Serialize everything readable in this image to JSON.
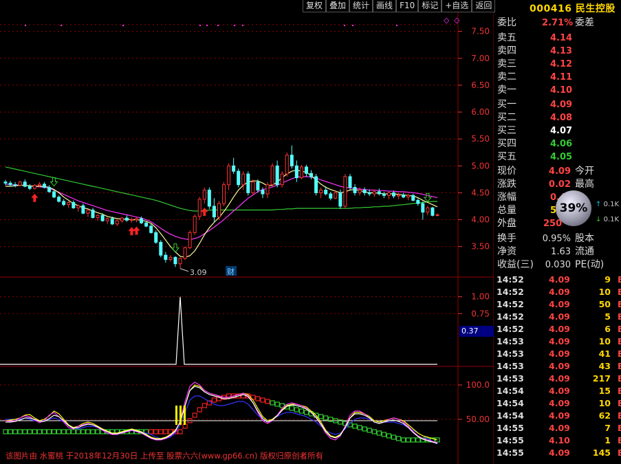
{
  "toolbar": [
    "复权",
    "叠加",
    "统计",
    "画线",
    "F10",
    "标记",
    "+自选",
    "返回"
  ],
  "stock": {
    "code": "000416",
    "name": "民生控股"
  },
  "order_book": {
    "weibi_label": "委比",
    "weibi_value": "2.71%",
    "weicha_label": "委差",
    "sells": [
      {
        "label": "卖五",
        "price": "4.14"
      },
      {
        "label": "卖四",
        "price": "4.13"
      },
      {
        "label": "卖三",
        "price": "4.12"
      },
      {
        "label": "卖二",
        "price": "4.11"
      },
      {
        "label": "卖一",
        "price": "4.10"
      }
    ],
    "buys": [
      {
        "label": "买一",
        "price": "4.09"
      },
      {
        "label": "买二",
        "price": "4.08"
      },
      {
        "label": "买三",
        "price": "4.07"
      },
      {
        "label": "买四",
        "price": "4.06"
      },
      {
        "label": "买五",
        "price": "4.05"
      }
    ]
  },
  "quote": {
    "xianjia_label": "现价",
    "xianjia": "4.09",
    "jinkai_label": "今开",
    "zhangdie_label": "涨跌",
    "zhangdie": "0.02",
    "zuigao_label": "最高",
    "zhangfu_label": "涨幅",
    "zhangfu": "0.49",
    "zongliang_label": "总量",
    "zongliang": "50",
    "waipan_label": "外盘",
    "waipan": "250",
    "huanshou_label": "换手",
    "huanshou": "0.95%",
    "guben_label": "股本",
    "jingzi_label": "净资",
    "jingzi": "1.63",
    "liutong_label": "流通",
    "shouyi_label": "收益(三)",
    "shouyi": "0.030",
    "pe_label": "PE(动)"
  },
  "badge": {
    "percent": "39%",
    "rate_up": "0.1K",
    "rate_down": "0.1K"
  },
  "ticks": [
    {
      "time": "14:52",
      "price": "4.09",
      "vol": "9"
    },
    {
      "time": "14:52",
      "price": "4.09",
      "vol": "10"
    },
    {
      "time": "14:52",
      "price": "4.09",
      "vol": "50"
    },
    {
      "time": "14:52",
      "price": "4.09",
      "vol": "5"
    },
    {
      "time": "14:52",
      "price": "4.09",
      "vol": "6"
    },
    {
      "time": "14:53",
      "price": "4.09",
      "vol": "10"
    },
    {
      "time": "14:53",
      "price": "4.09",
      "vol": "41"
    },
    {
      "time": "14:53",
      "price": "4.09",
      "vol": "43"
    },
    {
      "time": "14:53",
      "price": "4.09",
      "vol": "217"
    },
    {
      "time": "14:54",
      "price": "4.09",
      "vol": "15"
    },
    {
      "time": "14:54",
      "price": "4.09",
      "vol": "10"
    },
    {
      "time": "14:54",
      "price": "4.09",
      "vol": "62"
    },
    {
      "time": "14:55",
      "price": "4.09",
      "vol": "7"
    },
    {
      "time": "14:55",
      "price": "4.10",
      "vol": "1"
    },
    {
      "time": "14:55",
      "price": "4.09",
      "vol": "145"
    }
  ],
  "axes": {
    "main": [
      "7.50",
      "7.00",
      "6.50",
      "6.00",
      "5.50",
      "5.00",
      "4.50",
      "4.00",
      "3.50"
    ],
    "sub1": [
      "1.00",
      "0.75"
    ],
    "sub2": [
      "100.0",
      "50.00"
    ]
  },
  "sub1_value": "0.37",
  "low_label": "3.09",
  "cai_label": "财",
  "watermark": "该图片由 水蜜桃 于2018年12月30日 上传至 股票六六(www.gp66.cn) 版权归原创者所有",
  "colors": {
    "up": "#ff3333",
    "down": "#54ffff",
    "ma_white": "#ffff99",
    "ma_magenta": "#ff33ff",
    "ma_green": "#33cc33",
    "grid": "#990000"
  },
  "chart_data": {
    "type": "candlestick",
    "ylim": [
      3.1,
      7.7
    ],
    "candles": [
      [
        4.7,
        4.74,
        4.64,
        4.68
      ],
      [
        4.68,
        4.72,
        4.62,
        4.65
      ],
      [
        4.65,
        4.7,
        4.6,
        4.64
      ],
      [
        4.64,
        4.72,
        4.62,
        4.7
      ],
      [
        4.7,
        4.75,
        4.6,
        4.62
      ],
      [
        4.62,
        4.66,
        4.55,
        4.58
      ],
      [
        4.58,
        4.66,
        4.56,
        4.64
      ],
      [
        4.64,
        4.7,
        4.6,
        4.66
      ],
      [
        4.66,
        4.7,
        4.58,
        4.6
      ],
      [
        4.6,
        4.64,
        4.5,
        4.52
      ],
      [
        4.52,
        4.55,
        4.4,
        4.42
      ],
      [
        4.42,
        4.45,
        4.32,
        4.34
      ],
      [
        4.34,
        4.38,
        4.25,
        4.28
      ],
      [
        4.28,
        4.34,
        4.22,
        4.32
      ],
      [
        4.32,
        4.36,
        4.2,
        4.22
      ],
      [
        4.22,
        4.28,
        4.15,
        4.26
      ],
      [
        4.26,
        4.3,
        4.1,
        4.12
      ],
      [
        4.12,
        4.2,
        4.05,
        4.18
      ],
      [
        4.18,
        4.22,
        4.02,
        4.04
      ],
      [
        4.04,
        4.1,
        3.98,
        4.08
      ],
      [
        4.08,
        4.12,
        3.96,
        3.98
      ],
      [
        3.98,
        4.04,
        3.92,
        4.02
      ],
      [
        4.02,
        4.06,
        3.9,
        3.92
      ],
      [
        3.92,
        4.0,
        3.88,
        3.98
      ],
      [
        3.98,
        4.05,
        3.94,
        4.03
      ],
      [
        4.03,
        4.08,
        3.96,
        3.99
      ],
      [
        3.99,
        4.04,
        3.94,
        4.0
      ],
      [
        4.0,
        4.05,
        3.95,
        4.02
      ],
      [
        4.02,
        4.06,
        3.92,
        3.94
      ],
      [
        3.94,
        3.98,
        3.86,
        3.88
      ],
      [
        3.88,
        3.92,
        3.74,
        3.76
      ],
      [
        3.76,
        3.8,
        3.55,
        3.58
      ],
      [
        3.58,
        3.62,
        3.3,
        3.34
      ],
      [
        3.34,
        3.4,
        3.2,
        3.26
      ],
      [
        3.26,
        3.34,
        3.22,
        3.3
      ],
      [
        3.3,
        3.32,
        3.12,
        3.18
      ],
      [
        3.18,
        3.3,
        3.09,
        3.28
      ],
      [
        3.28,
        3.5,
        3.25,
        3.48
      ],
      [
        3.48,
        3.8,
        3.45,
        3.76
      ],
      [
        3.76,
        4.1,
        3.72,
        4.06
      ],
      [
        4.06,
        4.42,
        4.0,
        4.38
      ],
      [
        4.38,
        4.6,
        4.3,
        4.55
      ],
      [
        4.55,
        4.6,
        4.2,
        4.25
      ],
      [
        4.25,
        4.4,
        3.95,
        4.05
      ],
      [
        4.05,
        4.35,
        4.0,
        4.3
      ],
      [
        4.3,
        4.7,
        4.25,
        4.65
      ],
      [
        4.65,
        5.05,
        4.55,
        5.0
      ],
      [
        5.0,
        5.15,
        4.85,
        4.9
      ],
      [
        4.9,
        4.95,
        4.6,
        4.65
      ],
      [
        4.65,
        4.9,
        4.55,
        4.85
      ],
      [
        4.85,
        4.9,
        4.45,
        4.5
      ],
      [
        4.5,
        4.75,
        4.45,
        4.7
      ],
      [
        4.7,
        4.75,
        4.5,
        4.55
      ],
      [
        4.55,
        4.6,
        4.4,
        4.48
      ],
      [
        4.48,
        4.7,
        4.4,
        4.65
      ],
      [
        4.65,
        5.05,
        4.6,
        5.0
      ],
      [
        5.0,
        5.1,
        4.6,
        4.65
      ],
      [
        4.65,
        4.9,
        4.6,
        4.85
      ],
      [
        4.85,
        5.25,
        4.8,
        5.2
      ],
      [
        5.2,
        5.38,
        4.95,
        5.0
      ],
      [
        5.0,
        5.1,
        4.7,
        4.78
      ],
      [
        4.78,
        5.02,
        4.75,
        4.98
      ],
      [
        4.98,
        5.02,
        4.8,
        4.86
      ],
      [
        4.86,
        4.92,
        4.75,
        4.8
      ],
      [
        4.8,
        4.85,
        4.45,
        4.5
      ],
      [
        4.5,
        4.6,
        4.4,
        4.55
      ],
      [
        4.55,
        4.62,
        4.45,
        4.48
      ],
      [
        4.48,
        4.52,
        4.36,
        4.4
      ],
      [
        4.4,
        4.55,
        4.38,
        4.5
      ],
      [
        4.5,
        4.56,
        4.2,
        4.25
      ],
      [
        4.25,
        4.85,
        4.2,
        4.8
      ],
      [
        4.8,
        4.85,
        4.55,
        4.6
      ],
      [
        4.6,
        4.66,
        4.45,
        4.5
      ],
      [
        4.5,
        4.6,
        4.45,
        4.55
      ],
      [
        4.55,
        4.6,
        4.45,
        4.5
      ],
      [
        4.5,
        4.56,
        4.44,
        4.48
      ],
      [
        4.48,
        4.55,
        4.42,
        4.52
      ],
      [
        4.52,
        4.58,
        4.45,
        4.48
      ],
      [
        4.48,
        4.52,
        4.4,
        4.45
      ],
      [
        4.45,
        4.52,
        4.38,
        4.5
      ],
      [
        4.5,
        4.54,
        4.4,
        4.44
      ],
      [
        4.44,
        4.5,
        4.38,
        4.46
      ],
      [
        4.46,
        4.5,
        4.4,
        4.42
      ],
      [
        4.42,
        4.48,
        4.36,
        4.45
      ],
      [
        4.45,
        4.48,
        4.34,
        4.36
      ],
      [
        4.36,
        4.4,
        4.26,
        4.3
      ],
      [
        4.3,
        4.34,
        4.0,
        4.14
      ],
      [
        4.14,
        4.26,
        4.08,
        4.22
      ],
      [
        4.22,
        4.24,
        4.06,
        4.08
      ],
      [
        4.08,
        4.12,
        4.06,
        4.09
      ]
    ],
    "ma_white": [
      4.62,
      4.62,
      4.63,
      4.64,
      4.64,
      4.63,
      4.62,
      4.62,
      4.62,
      4.6,
      4.56,
      4.5,
      4.42,
      4.36,
      4.3,
      4.26,
      4.22,
      4.2,
      4.16,
      4.13,
      4.1,
      4.06,
      4.04,
      4.02,
      4.01,
      4.01,
      4.0,
      4.0,
      3.99,
      3.97,
      3.93,
      3.85,
      3.74,
      3.62,
      3.5,
      3.4,
      3.32,
      3.3,
      3.33,
      3.42,
      3.56,
      3.72,
      3.85,
      3.95,
      4.04,
      4.15,
      4.28,
      4.42,
      4.55,
      4.64,
      4.7,
      4.72,
      4.72,
      4.68,
      4.63,
      4.64,
      4.7,
      4.78,
      4.85,
      4.9,
      4.92,
      4.9,
      4.88,
      4.82,
      4.74,
      4.66,
      4.6,
      4.56,
      4.53,
      4.5,
      4.52,
      4.55,
      4.56,
      4.54,
      4.52,
      4.5,
      4.5,
      4.49,
      4.48,
      4.48,
      4.48,
      4.47,
      4.46,
      4.45,
      4.44,
      4.41,
      4.36,
      4.32,
      4.28,
      4.24
    ],
    "ma_magenta": [
      4.66,
      4.65,
      4.65,
      4.64,
      4.64,
      4.63,
      4.62,
      4.61,
      4.6,
      4.58,
      4.55,
      4.51,
      4.47,
      4.43,
      4.39,
      4.35,
      4.32,
      4.29,
      4.26,
      4.23,
      4.2,
      4.17,
      4.15,
      4.13,
      4.11,
      4.09,
      4.07,
      4.05,
      4.03,
      4.0,
      3.96,
      3.9,
      3.84,
      3.78,
      3.73,
      3.69,
      3.66,
      3.64,
      3.63,
      3.65,
      3.68,
      3.74,
      3.8,
      3.86,
      3.93,
      4.0,
      4.08,
      4.16,
      4.24,
      4.32,
      4.4,
      4.46,
      4.52,
      4.56,
      4.58,
      4.61,
      4.64,
      4.68,
      4.72,
      4.76,
      4.79,
      4.8,
      4.8,
      4.79,
      4.77,
      4.74,
      4.71,
      4.68,
      4.65,
      4.62,
      4.6,
      4.59,
      4.58,
      4.57,
      4.56,
      4.55,
      4.55,
      4.54,
      4.54,
      4.53,
      4.53,
      4.52,
      4.52,
      4.51,
      4.5,
      4.49,
      4.47,
      4.45,
      4.43,
      4.41
    ],
    "ma_green": [
      4.98,
      4.96,
      4.94,
      4.92,
      4.9,
      4.88,
      4.86,
      4.84,
      4.82,
      4.8,
      4.78,
      4.76,
      4.74,
      4.72,
      4.7,
      4.68,
      4.66,
      4.64,
      4.62,
      4.6,
      4.58,
      4.56,
      4.54,
      4.52,
      4.5,
      4.48,
      4.46,
      4.44,
      4.42,
      4.4,
      4.38,
      4.36,
      4.33,
      4.3,
      4.27,
      4.24,
      4.21,
      4.19,
      4.17,
      4.16,
      4.16,
      4.17,
      4.18,
      4.18,
      4.18,
      4.18,
      4.18,
      4.18,
      4.18,
      4.18,
      4.18,
      4.18,
      4.18,
      4.18,
      4.18,
      4.18,
      4.19,
      4.19,
      4.2,
      4.2,
      4.21,
      4.21,
      4.21,
      4.21,
      4.21,
      4.21,
      4.21,
      4.21,
      4.21,
      4.21,
      4.21,
      4.21,
      4.22,
      4.22,
      4.23,
      4.23,
      4.24,
      4.24,
      4.25,
      4.25,
      4.26,
      4.27,
      4.28,
      4.29,
      4.3,
      4.31,
      4.32,
      4.33,
      4.34,
      4.34
    ],
    "sub1": {
      "ylim": [
        0,
        1.2
      ],
      "spike_index": 36,
      "spike_value": 1.0
    },
    "sub2": {
      "ylim": [
        0,
        120
      ],
      "line_white": [
        48,
        47,
        48,
        52,
        55,
        54,
        49,
        45,
        48,
        56,
        60,
        54,
        46,
        38,
        36,
        40,
        42,
        44,
        42,
        38,
        34,
        30,
        28,
        28,
        30,
        32,
        34,
        32,
        30,
        26,
        22,
        20,
        20,
        22,
        26,
        32,
        48,
        76,
        98,
        104,
        100,
        92,
        88,
        86,
        84,
        82,
        82,
        84,
        86,
        88,
        84,
        74,
        60,
        48,
        44,
        48,
        56,
        66,
        72,
        74,
        72,
        70,
        66,
        60,
        52,
        42,
        30,
        22,
        20,
        26,
        40,
        56,
        62,
        62,
        58,
        52,
        46,
        44,
        46,
        50,
        52,
        50,
        46,
        40,
        32,
        26,
        22,
        20,
        18,
        16
      ],
      "line_yellow": [
        48,
        49,
        50,
        52,
        56,
        57,
        52,
        48,
        50,
        55,
        62,
        58,
        50,
        42,
        38,
        40,
        44,
        46,
        44,
        40,
        36,
        33,
        30,
        30,
        32,
        34,
        36,
        34,
        32,
        28,
        24,
        22,
        22,
        24,
        28,
        34,
        46,
        70,
        92,
        100,
        98,
        92,
        88,
        86,
        84,
        82,
        82,
        84,
        86,
        88,
        86,
        78,
        66,
        54,
        48,
        50,
        56,
        64,
        70,
        72,
        72,
        70,
        68,
        62,
        56,
        46,
        34,
        26,
        24,
        28,
        38,
        52,
        60,
        60,
        58,
        54,
        48,
        46,
        48,
        50,
        52,
        50,
        48,
        42,
        36,
        30,
        26,
        24,
        22,
        20
      ],
      "line_blue": [
        50,
        50,
        50,
        50,
        52,
        50,
        48,
        48,
        48,
        50,
        52,
        50,
        46,
        42,
        38,
        36,
        38,
        40,
        40,
        38,
        34,
        32,
        30,
        30,
        32,
        32,
        34,
        34,
        32,
        30,
        28,
        24,
        22,
        22,
        24,
        30,
        42,
        60,
        78,
        84,
        84,
        80,
        76,
        72,
        70,
        70,
        72,
        74,
        76,
        76,
        72,
        64,
        56,
        50,
        48,
        50,
        54,
        58,
        60,
        60,
        58,
        56,
        54,
        50,
        46,
        40,
        34,
        30,
        28,
        30,
        36,
        44,
        50,
        52,
        52,
        50,
        48,
        46,
        46,
        46,
        46,
        44,
        42,
        38,
        34,
        30,
        26,
        22,
        18,
        14
      ],
      "line_white_thin": [
        46,
        46,
        47,
        49,
        52,
        52,
        50,
        47,
        47,
        51,
        56,
        54,
        48,
        41,
        37,
        38,
        41,
        43,
        42,
        39,
        35,
        32,
        29,
        29,
        31,
        33,
        35,
        33,
        31,
        27,
        23,
        21,
        21,
        23,
        27,
        33,
        46,
        70,
        92,
        98,
        96,
        90,
        86,
        84,
        82,
        80,
        80,
        82,
        84,
        86,
        83,
        74,
        62,
        51,
        46,
        49,
        55,
        63,
        69,
        71,
        70,
        68,
        65,
        60,
        53,
        43,
        32,
        25,
        23,
        27,
        38,
        52,
        58,
        58,
        56,
        52,
        46,
        44,
        46,
        48,
        49,
        47,
        44,
        38,
        31,
        25,
        21,
        19,
        17,
        15
      ],
      "ladder": [
        32,
        32,
        32,
        32,
        32,
        32,
        32,
        32,
        32,
        32,
        32,
        32,
        32,
        32,
        32,
        32,
        32,
        32,
        32,
        32,
        32,
        32,
        32,
        32,
        32,
        32,
        32,
        32,
        32,
        32,
        32,
        32,
        32,
        32,
        32,
        32,
        32,
        40,
        48,
        56,
        64,
        70,
        74,
        78,
        80,
        82,
        84,
        84,
        84,
        84,
        84,
        82,
        80,
        78,
        76,
        74,
        72,
        70,
        68,
        66,
        64,
        62,
        60,
        58,
        56,
        54,
        52,
        50,
        48,
        46,
        44,
        42,
        40,
        38,
        36,
        34,
        32,
        30,
        28,
        26,
        24,
        22,
        20,
        20,
        20,
        20,
        20,
        20,
        20,
        20
      ]
    }
  }
}
